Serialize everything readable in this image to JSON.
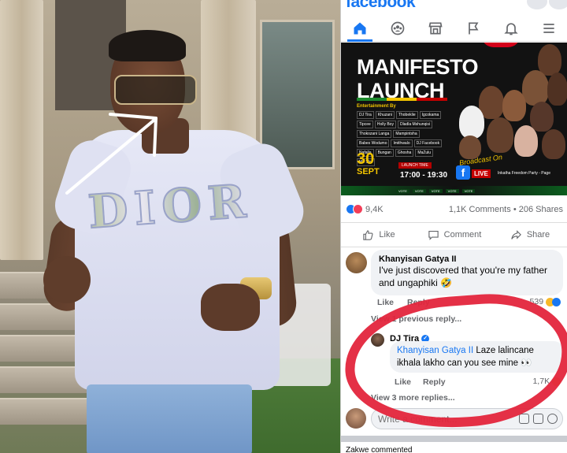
{
  "facebook": {
    "brand": "facebook",
    "nav": [
      "home",
      "groups",
      "marketplace",
      "pages",
      "notifications",
      "menu"
    ],
    "post": {
      "poster": {
        "title_line1": "MANIFESTO",
        "title_line2": "LAUNCH",
        "entertainment_label": "Entertainment By",
        "names": [
          "DJ Tira",
          "Khuzani",
          "Thobeklie",
          "Igcokama",
          "Tipcee",
          "Holly Boy",
          "Dladla Mshunqisi",
          "Thokozani Langa",
          "Mampintsha",
          "Babes Wodumo",
          "Imithwalo",
          "DJ Facebook",
          "Nafalla",
          "Bungan",
          "Ghosha",
          "MaZulu",
          "Mo Slot"
        ],
        "date_day": "30",
        "date_month": "SEPT",
        "launch_time_label": "LAUNCH TIME",
        "launch_time": "17:00 - 19:30",
        "broadcast": "Broadcast On",
        "live": "LIVE",
        "party_page": "Inkatha Freedom Party - Page",
        "vote": "VOTE"
      },
      "reactions": {
        "count": "9,4K",
        "comments": "1,1K Comments",
        "shares": "206 Shares",
        "separator": "•"
      },
      "actions": {
        "like": "Like",
        "comment": "Comment",
        "share": "Share"
      }
    },
    "comments": {
      "first": {
        "name": "Khanyisan Gatya II",
        "text": "I've just discovered that you're my father and ungaphiki 🤣",
        "like": "Like",
        "reply": "Reply",
        "reaction_count": "539"
      },
      "view_previous": "View 1 previous reply...",
      "reply": {
        "name": "DJ Tira",
        "mention": "Khanyisan Gatya II",
        "text": " Laze lalincane ikhala lakho can you see mine 👀",
        "like": "Like",
        "reply": "Reply",
        "reaction_count": "1,7K"
      },
      "view_more": "View 3 more replies...",
      "write_placeholder": "Write a comment...",
      "next_comment": "Zakwe commented"
    }
  },
  "colors": {
    "facebook_blue": "#1877f2",
    "highlight_red": "#e3253c"
  }
}
